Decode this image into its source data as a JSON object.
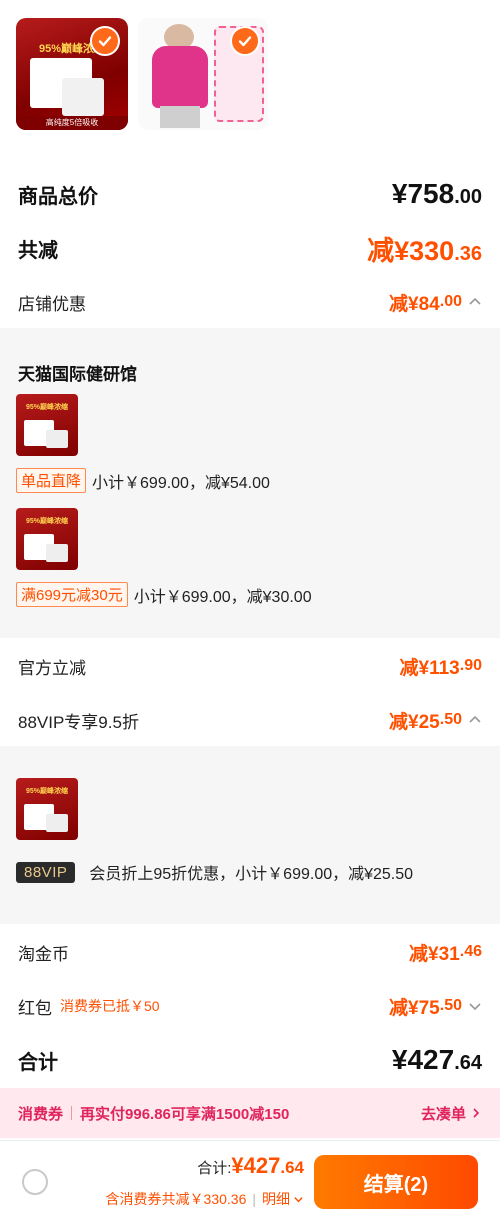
{
  "thumbnails": {
    "product_title": "95%巅峰浓缩",
    "product_band": "高纯度5倍吸收"
  },
  "summary": {
    "total_label": "商品总价",
    "total_int": "¥758",
    "total_dec": ".00",
    "reduce_label": "共减",
    "reduce_int": "减¥330",
    "reduce_dec": ".36",
    "shop_label": "店铺优惠",
    "shop_int": "减¥84",
    "shop_dec": ".00"
  },
  "shop_panel": {
    "shop_name": "天猫国际健研馆",
    "items": [
      {
        "tag": "单品直降",
        "text": "小计￥699.00，减¥54.00"
      },
      {
        "tag": "满699元减30元",
        "text": "小计￥699.00，减¥30.00"
      }
    ]
  },
  "official": {
    "label": "官方立减",
    "amount_int": "减¥113",
    "amount_dec": ".90"
  },
  "vip": {
    "label": "88VIP专享9.5折",
    "amount_int": "减¥25",
    "amount_dec": ".50",
    "badge": "88VIP",
    "text": "会员折上95折优惠，小计￥699.00，减¥25.50"
  },
  "coins": {
    "label": "淘金币",
    "amount_int": "减¥31",
    "amount_dec": ".46"
  },
  "redpacket": {
    "label": "红包",
    "sub": "消费券已抵￥50",
    "amount_int": "减¥75",
    "amount_dec": ".50"
  },
  "total": {
    "label": "合计",
    "amount_int": "¥427",
    "amount_dec": ".64"
  },
  "promo": {
    "tag": "消费券",
    "text": "再实付996.86可享满1500减150",
    "action": "去凑单"
  },
  "bottom": {
    "sum_label": "合计:",
    "sum_int": "¥427",
    "sum_dec": ".64",
    "sub_text": "含消费券共减￥330.36",
    "detail": "明细",
    "pay_label": "结算(2)"
  },
  "colors": {
    "accent": "#ff5000",
    "promo_bg": "#ffe8ee",
    "panel_bg": "#f6f6f6"
  }
}
